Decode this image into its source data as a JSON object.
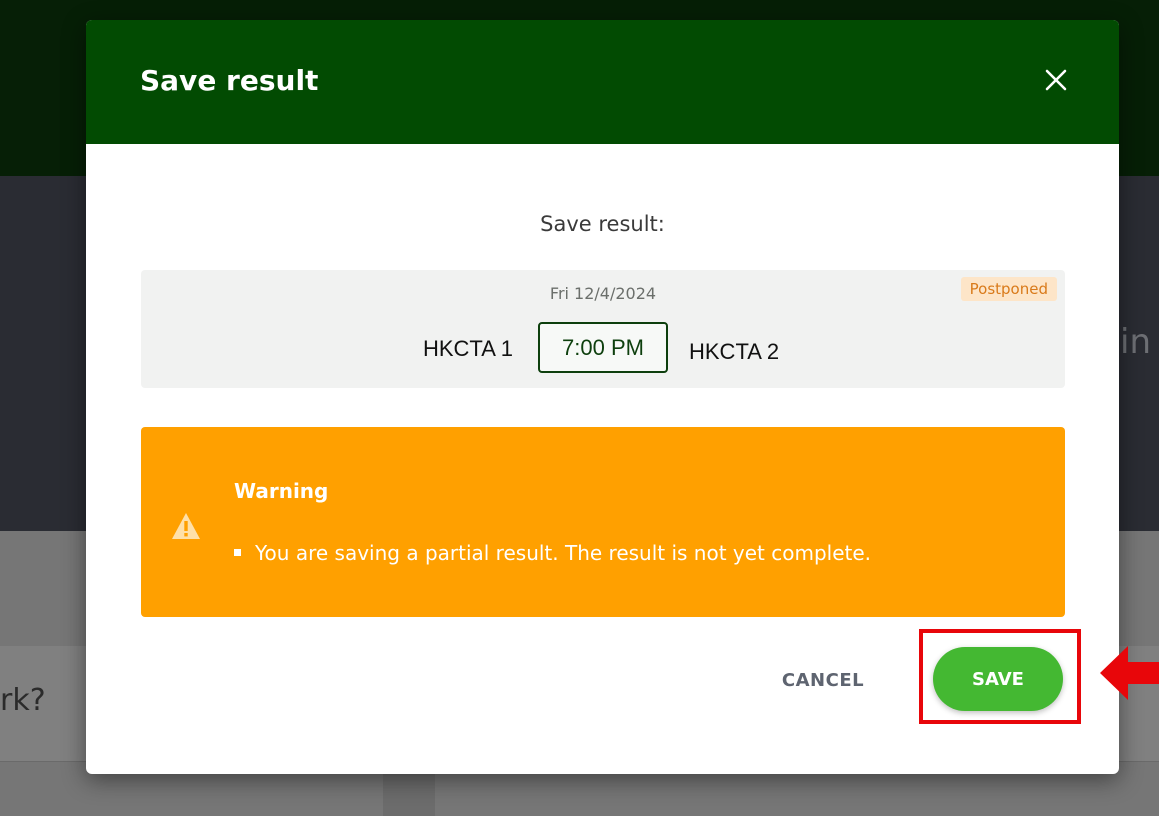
{
  "background": {
    "partial_text_left": "rk?",
    "partial_text_right": "in"
  },
  "modal": {
    "title": "Save result",
    "close_icon": "close-icon",
    "subtitle": "Save result:",
    "match": {
      "date": "Fri 12/4/2024",
      "status": "Postponed",
      "home_team": "HKCTA 1",
      "time": "7:00 PM",
      "away_team": "HKCTA 2"
    },
    "warning": {
      "icon": "warning-icon",
      "title": "Warning",
      "messages": [
        "You are saving a partial result. The result is not yet complete."
      ]
    },
    "actions": {
      "cancel_label": "CANCEL",
      "save_label": "SAVE"
    }
  },
  "annotation": {
    "highlight_target": "save-button",
    "arrow_icon": "arrow-left-icon",
    "color": "#e8060a"
  },
  "colors": {
    "header": "#024b02",
    "warning": "#ffa000",
    "save": "#44b832",
    "status_badge_bg": "#fde5c8",
    "status_badge_text": "#d97a1a"
  }
}
